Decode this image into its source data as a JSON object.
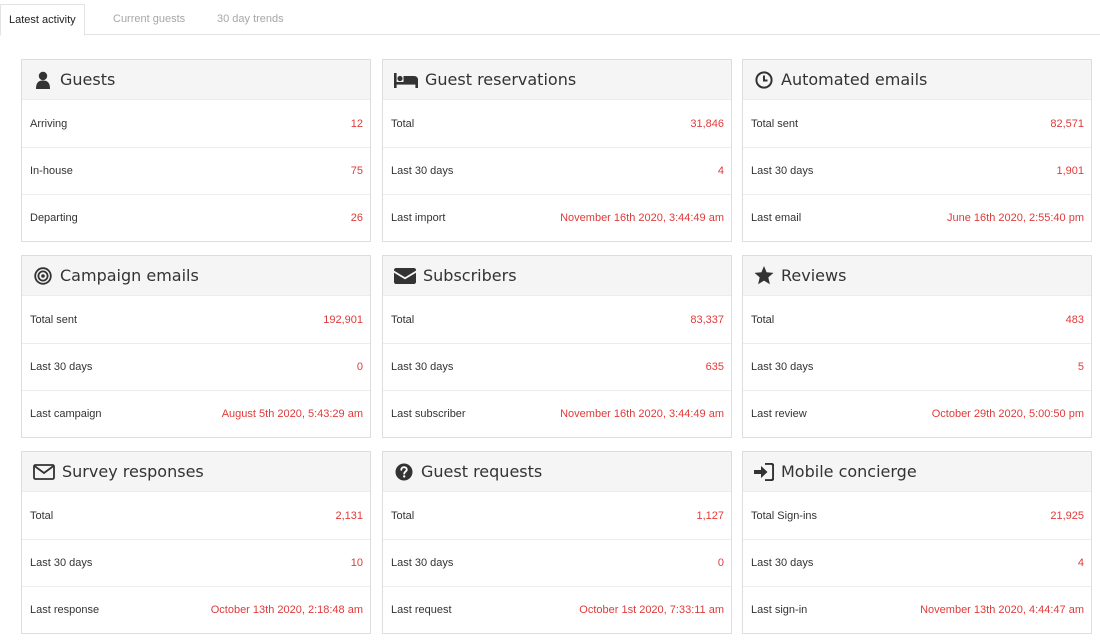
{
  "tabs": [
    {
      "label": "Latest activity",
      "active": true
    },
    {
      "label": "Current guests",
      "active": false
    },
    {
      "label": "30 day trends",
      "active": false
    }
  ],
  "accent_color": "#e03a3a",
  "panels": [
    {
      "title": "Guests",
      "icon": "user-icon",
      "rows": [
        {
          "label": "Arriving",
          "value": "12"
        },
        {
          "label": "In-house",
          "value": "75"
        },
        {
          "label": "Departing",
          "value": "26"
        }
      ]
    },
    {
      "title": "Guest reservations",
      "icon": "bed-icon",
      "rows": [
        {
          "label": "Total",
          "value": "31,846"
        },
        {
          "label": "Last 30 days",
          "value": "4"
        },
        {
          "label": "Last import",
          "value": "November 16th 2020, 3:44:49 am"
        }
      ]
    },
    {
      "title": "Automated emails",
      "icon": "clock-icon",
      "rows": [
        {
          "label": "Total sent",
          "value": "82,571"
        },
        {
          "label": "Last 30 days",
          "value": "1,901"
        },
        {
          "label": "Last email",
          "value": "June 16th 2020, 2:55:40 pm"
        }
      ]
    },
    {
      "title": "Campaign emails",
      "icon": "bullseye-icon",
      "rows": [
        {
          "label": "Total sent",
          "value": "192,901"
        },
        {
          "label": "Last 30 days",
          "value": "0"
        },
        {
          "label": "Last campaign",
          "value": "August 5th 2020, 5:43:29 am"
        }
      ]
    },
    {
      "title": "Subscribers",
      "icon": "envelope-solid-icon",
      "rows": [
        {
          "label": "Total",
          "value": "83,337"
        },
        {
          "label": "Last 30 days",
          "value": "635"
        },
        {
          "label": "Last subscriber",
          "value": "November 16th 2020, 3:44:49 am"
        }
      ]
    },
    {
      "title": "Reviews",
      "icon": "star-icon",
      "rows": [
        {
          "label": "Total",
          "value": "483"
        },
        {
          "label": "Last 30 days",
          "value": "5"
        },
        {
          "label": "Last review",
          "value": "October 29th 2020, 5:00:50 pm"
        }
      ]
    },
    {
      "title": "Survey responses",
      "icon": "envelope-outline-icon",
      "rows": [
        {
          "label": "Total",
          "value": "2,131"
        },
        {
          "label": "Last 30 days",
          "value": "10"
        },
        {
          "label": "Last response",
          "value": "October 13th 2020, 2:18:48 am"
        }
      ]
    },
    {
      "title": "Guest requests",
      "icon": "question-circle-icon",
      "rows": [
        {
          "label": "Total",
          "value": "1,127"
        },
        {
          "label": "Last 30 days",
          "value": "0"
        },
        {
          "label": "Last request",
          "value": "October 1st 2020, 7:33:11 am"
        }
      ]
    },
    {
      "title": "Mobile concierge",
      "icon": "sign-in-icon",
      "rows": [
        {
          "label": "Total Sign-ins",
          "value": "21,925"
        },
        {
          "label": "Last 30 days",
          "value": "4"
        },
        {
          "label": "Last sign-in",
          "value": "November 13th 2020, 4:44:47 am"
        }
      ]
    }
  ]
}
